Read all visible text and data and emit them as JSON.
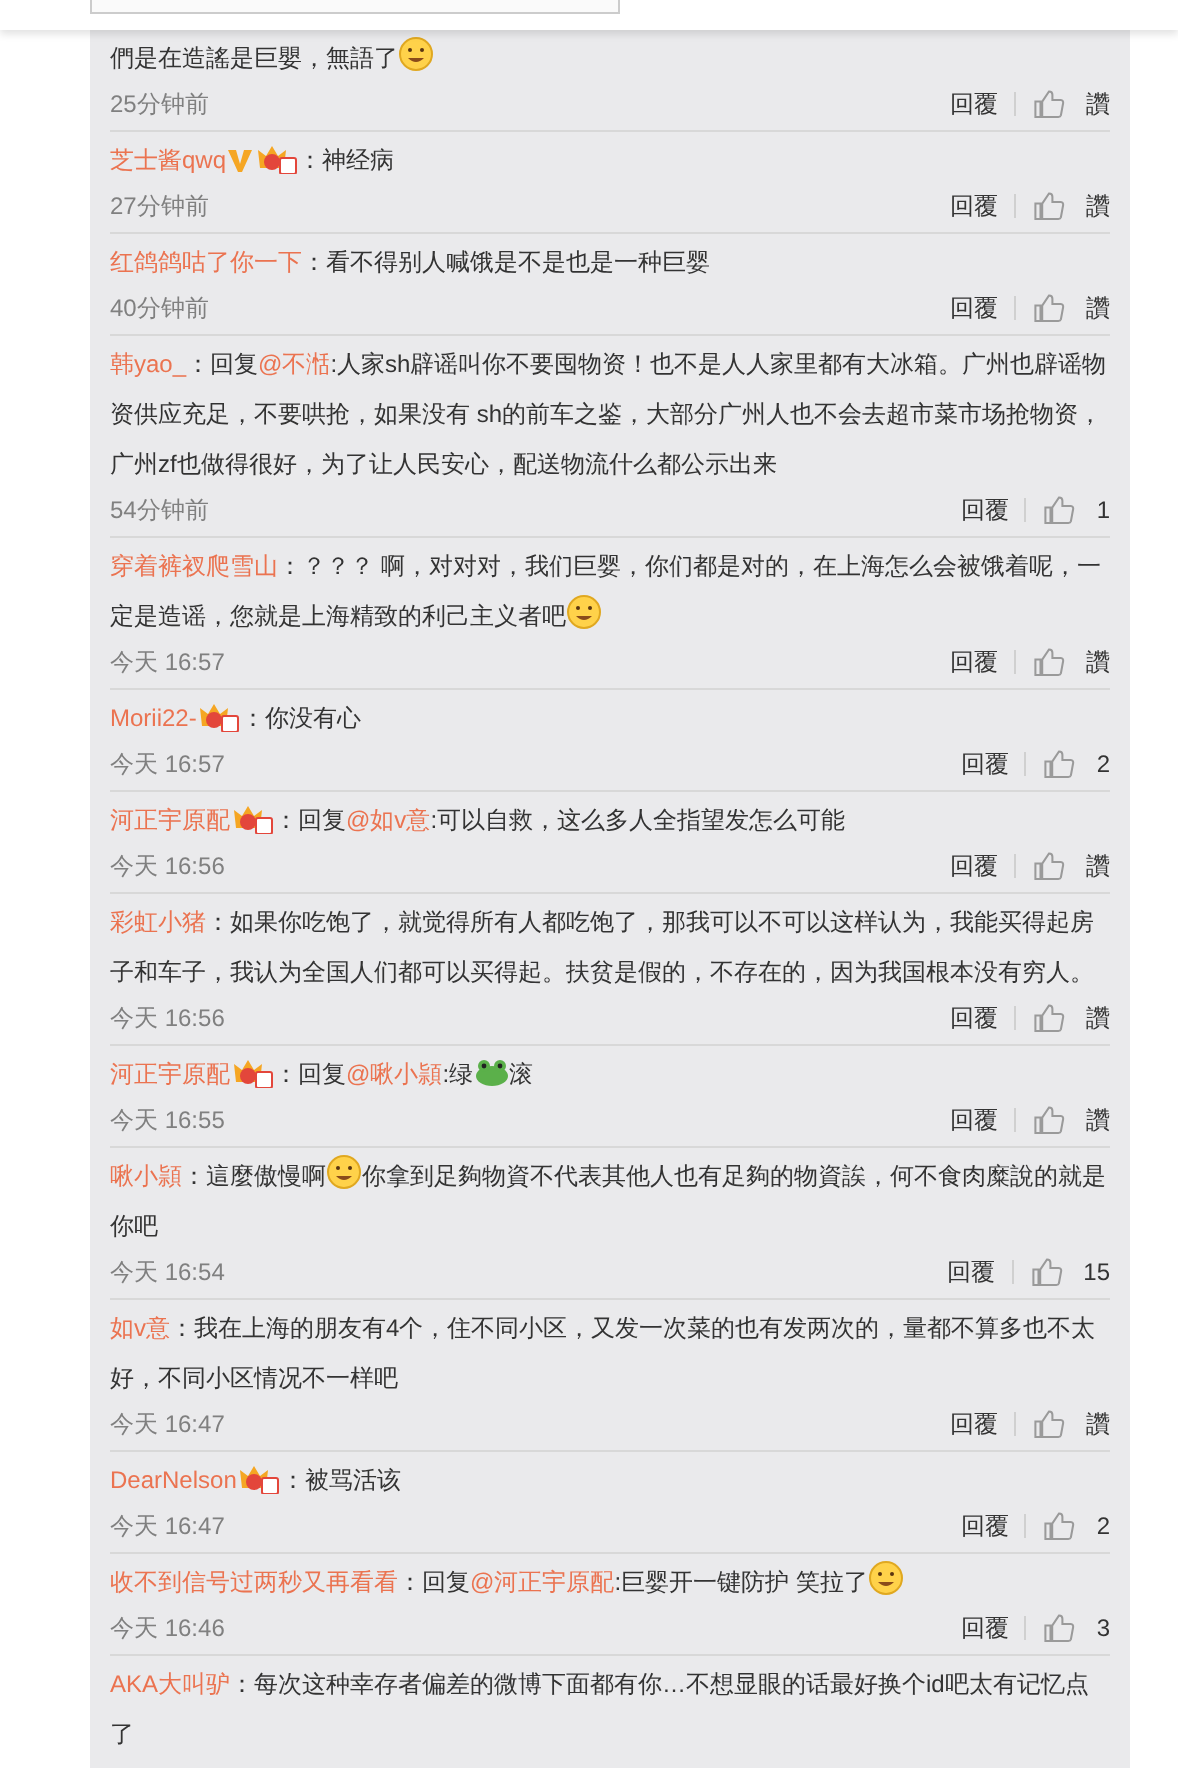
{
  "comments": [
    {
      "parts": [
        {
          "kind": "text",
          "text": "們是在造謠是巨嬰，無語了"
        },
        {
          "kind": "emoji"
        }
      ],
      "time": "25分钟前",
      "reply": "回覆",
      "like": "讚"
    },
    {
      "user": "芝士酱qwq",
      "badges": [
        {
          "kind": "vip"
        },
        {
          "kind": "crown"
        }
      ],
      "parts": [
        {
          "kind": "text",
          "text": "：神经病"
        }
      ],
      "time": "27分钟前",
      "reply": "回覆",
      "like": "讚"
    },
    {
      "user": "红鸽鸽咕了你一下",
      "parts": [
        {
          "kind": "text",
          "text": "：看不得别人喊饿是不是也是一种巨婴"
        }
      ],
      "time": "40分钟前",
      "reply": "回覆",
      "like": "讚"
    },
    {
      "user": "韩yao_",
      "parts": [
        {
          "kind": "text",
          "text": "：回复"
        },
        {
          "kind": "mention",
          "text": "@不湉"
        },
        {
          "kind": "text",
          "text": ":人家sh辟谣叫你不要囤物资！也不是人人家里都有大冰箱。广州也辟谣物资供应充足，不要哄抢，如果没有 sh的前车之鉴，大部分广州人也不会去超市菜市场抢物资，广州zf也做得很好，为了让人民安心，配送物流什么都公示出来"
        }
      ],
      "time": "54分钟前",
      "reply": "回覆",
      "like": "1"
    },
    {
      "user": "穿着裤衩爬雪山",
      "parts": [
        {
          "kind": "text",
          "text": "：？？？ 啊，对对对，我们巨婴，你们都是对的，在上海怎么会被饿着呢，一定是造谣，您就是上海精致的利己主义者吧"
        },
        {
          "kind": "emoji"
        }
      ],
      "time": "今天 16:57",
      "reply": "回覆",
      "like": "讚"
    },
    {
      "user": "Morii22-",
      "badges": [
        {
          "kind": "crown"
        }
      ],
      "parts": [
        {
          "kind": "text",
          "text": "：你没有心"
        }
      ],
      "time": "今天 16:57",
      "reply": "回覆",
      "like": "2"
    },
    {
      "user": "河正宇原配",
      "badges": [
        {
          "kind": "crown"
        }
      ],
      "parts": [
        {
          "kind": "text",
          "text": "：回复"
        },
        {
          "kind": "mention",
          "text": "@如v意"
        },
        {
          "kind": "text",
          "text": ":可以自救，这么多人全指望发怎么可能"
        }
      ],
      "time": "今天 16:56",
      "reply": "回覆",
      "like": "讚"
    },
    {
      "user": "彩虹小猪",
      "parts": [
        {
          "kind": "text",
          "text": "：如果你吃饱了，就觉得所有人都吃饱了，那我可以不可以这样认为，我能买得起房子和车子，我认为全国人们都可以买得起。扶贫是假的，不存在的，因为我国根本没有穷人。"
        }
      ],
      "time": "今天 16:56",
      "reply": "回覆",
      "like": "讚"
    },
    {
      "user": "河正宇原配",
      "badges": [
        {
          "kind": "crown"
        }
      ],
      "parts": [
        {
          "kind": "text",
          "text": "：回复"
        },
        {
          "kind": "mention",
          "text": "@啾小頴"
        },
        {
          "kind": "text",
          "text": ":绿"
        },
        {
          "kind": "frog"
        },
        {
          "kind": "text",
          "text": "滚"
        }
      ],
      "time": "今天 16:55",
      "reply": "回覆",
      "like": "讚"
    },
    {
      "user": "啾小頴",
      "parts": [
        {
          "kind": "text",
          "text": "：這麼傲慢啊"
        },
        {
          "kind": "emoji"
        },
        {
          "kind": "text",
          "text": "你拿到足夠物資不代表其他人也有足夠的物資誒，何不食肉糜說的就是你吧"
        }
      ],
      "time": "今天 16:54",
      "reply": "回覆",
      "like": "15"
    },
    {
      "user": "如v意",
      "parts": [
        {
          "kind": "text",
          "text": "：我在上海的朋友有4个，住不同小区，又发一次菜的也有发两次的，量都不算多也不太好，不同小区情况不一样吧"
        }
      ],
      "time": "今天 16:47",
      "reply": "回覆",
      "like": "讚"
    },
    {
      "user": "DearNelson",
      "badges": [
        {
          "kind": "crown"
        }
      ],
      "parts": [
        {
          "kind": "text",
          "text": "：被骂活该"
        }
      ],
      "time": "今天 16:47",
      "reply": "回覆",
      "like": "2"
    },
    {
      "user": "收不到信号过两秒又再看看",
      "parts": [
        {
          "kind": "text",
          "text": "：回复"
        },
        {
          "kind": "mention",
          "text": "@河正宇原配"
        },
        {
          "kind": "text",
          "text": ":巨婴开一键防护 笑拉了"
        },
        {
          "kind": "emoji"
        }
      ],
      "time": "今天 16:46",
      "reply": "回覆",
      "like": "3"
    },
    {
      "user": "AKA大叫驴",
      "parts": [
        {
          "kind": "text",
          "text": "：每次这种幸存者偏差的微博下面都有你…不想显眼的话最好换个id吧太有记忆点了"
        }
      ]
    }
  ]
}
